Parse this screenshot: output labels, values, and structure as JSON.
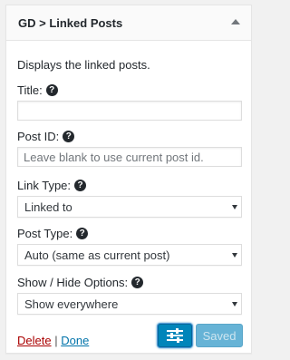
{
  "widget": {
    "title": "GD > Linked Posts",
    "description": "Displays the linked posts.",
    "fields": {
      "title": {
        "label": "Title:",
        "value": ""
      },
      "post_id": {
        "label": "Post ID:",
        "placeholder": "Leave blank to use current post id."
      },
      "link_type": {
        "label": "Link Type:",
        "selected": "Linked to"
      },
      "post_type": {
        "label": "Post Type:",
        "selected": "Auto (same as current post)"
      },
      "show_hide": {
        "label": "Show / Hide Options:",
        "selected": "Show everywhere"
      }
    },
    "help_glyph": "?",
    "actions": {
      "delete_label": "Delete",
      "separator": "|",
      "done_label": "Done",
      "saved_label": "Saved"
    },
    "icons": {
      "toggle": "collapse-arrow-up-icon",
      "settings": "sliders-icon",
      "help": "question-circle-icon"
    },
    "colors": {
      "primary_button": "#0085ba",
      "saved_button": "#66b3d6",
      "delete_link": "#aa0000",
      "done_link": "#0073aa"
    }
  }
}
